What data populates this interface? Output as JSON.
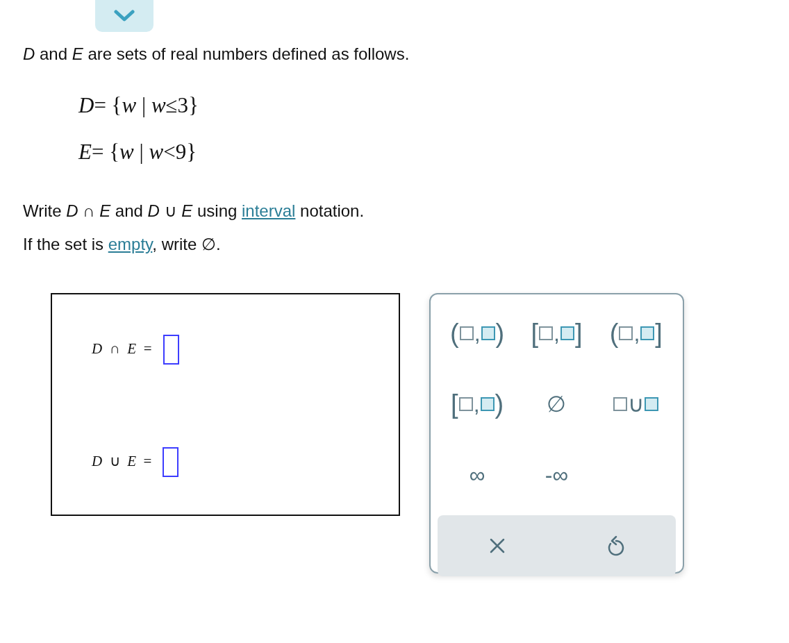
{
  "intro": "*D* and *E* are sets of real numbers defined as follows.",
  "sets": [
    {
      "definition": "*D*= {*w* | *w*≤3}"
    },
    {
      "definition": "*E*= {*w* | *w*<9}"
    }
  ],
  "instructions": [
    {
      "before": "Write *D* ∩ *E* and *D* ∪ *E* using ",
      "link": "interval",
      "after": " notation."
    },
    {
      "before": "If the set is ",
      "link": "empty",
      "after": ", write ∅."
    }
  ],
  "answers": [
    {
      "label": "*D*  ∩  *E*  ="
    },
    {
      "label": "*D*  ∪  *E*  ="
    }
  ],
  "keypad": {
    "keys": [
      {
        "kind": "interval",
        "open": "(",
        "sep": ",",
        "close": ")"
      },
      {
        "kind": "interval",
        "open": "[",
        "sep": ",",
        "close": "]"
      },
      {
        "kind": "interval",
        "open": "(",
        "sep": ",",
        "close": "]"
      },
      {
        "kind": "interval",
        "open": "[",
        "sep": ",",
        "close": ")"
      },
      {
        "kind": "symbol",
        "symbol": "∅"
      },
      {
        "kind": "union",
        "symbol": "∪"
      },
      {
        "kind": "symbol",
        "symbol": "∞"
      },
      {
        "kind": "symbol",
        "symbol": "-∞"
      }
    ],
    "actions": [
      {
        "kind": "clear"
      },
      {
        "kind": "undo"
      }
    ]
  }
}
